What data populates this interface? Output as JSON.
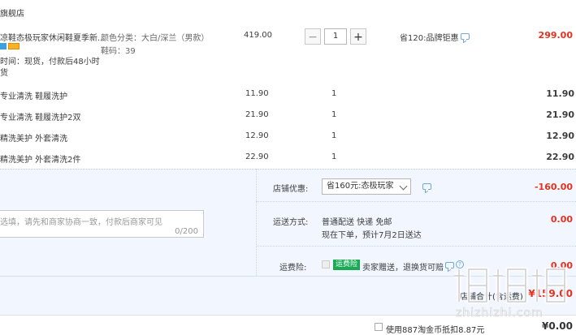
{
  "shop": {
    "name": "旗舰店"
  },
  "main_item": {
    "title": "凉鞋态极玩家休闲鞋夏季新...",
    "sku_color": "颜色分类：大白/深兰（男款）",
    "sku_size": "鞋码：39",
    "ship_time_1": "时间：现货，付款后48小时",
    "ship_time_2": "货",
    "unit_price": "419.00",
    "quantity": "1",
    "promo": "省120:品牌钜惠",
    "subtotal": "299.00",
    "minus_icon": "minus-icon",
    "plus_icon": "plus-icon"
  },
  "services": [
    {
      "name": "专业清洗 鞋履洗护",
      "price": "11.90",
      "qty": "1",
      "total": "11.90"
    },
    {
      "name": "专业清洗 鞋履洗护2双",
      "price": "21.90",
      "qty": "1",
      "total": "21.90"
    },
    {
      "name": "精洗美护 外套清洗",
      "price": "12.90",
      "qty": "1",
      "total": "12.90"
    },
    {
      "name": "精洗美护 外套清洗2件",
      "price": "22.90",
      "qty": "1",
      "total": "22.90"
    }
  ],
  "order": {
    "store_discount_label": "店铺优惠:",
    "store_discount_option": "省160元:态极玩家",
    "store_discount_value": "-160.00",
    "message_placeholder": "选填，请先和商家协商一致，付款后商家可见",
    "message_count": "0/200",
    "shipping_label": "运送方式:",
    "shipping_method": "普通配送 快递 免邮",
    "shipping_note": "现在下单，预计7月2日送达",
    "shipping_value": "0.00",
    "insurance_label": "运费险:",
    "insurance_tag": "运费险",
    "insurance_text": "卖家赠送，退换货可赔",
    "insurance_value": "0.00",
    "total_label": "店铺合计(含运费)",
    "total_value": "¥159.00"
  },
  "bottom": {
    "coupon_text": "使用887淘金币抵扣8.87元",
    "amount": "¥0.00"
  },
  "colors": {
    "accent_red": "#e5311e",
    "panel_blue": "#f2f7ff",
    "green_tag": "#1aaa55"
  }
}
